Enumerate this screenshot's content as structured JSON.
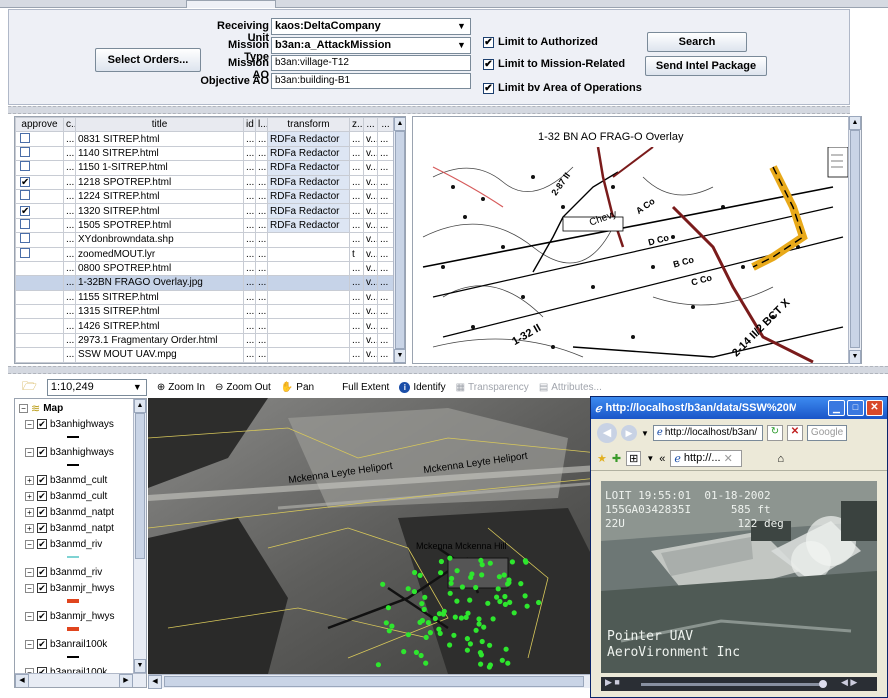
{
  "orders": {
    "select_label": "Select Orders...",
    "receiving_unit_label": "Receiving Unit",
    "receiving_unit_value": "kaos:DeltaCompany",
    "mission_type_label": "Mission Type",
    "mission_type_value": "b3an:a_AttackMission",
    "mission_ao_label": "Mission AO",
    "mission_ao_value": "b3an:village-T12",
    "objective_ao_label": "Objective AO",
    "objective_ao_value": "b3an:building-B1",
    "limit_authorized": "Limit to Authorized",
    "limit_mission": "Limit to Mission-Related",
    "limit_area": "Limit bv Area of Operations",
    "search_label": "Search",
    "send_intel_label": "Send Intel Package"
  },
  "table": {
    "headers": [
      "approve",
      "c...",
      "title",
      "id",
      "l...",
      "transform",
      "z...",
      "...",
      "..."
    ],
    "rows": [
      {
        "checked": false,
        "c": "...",
        "title": "0831 SITREP.html",
        "id": "...",
        "l": "...",
        "transform": "RDFa Redactor",
        "z": "...",
        "d1": "v...",
        "d2": "..."
      },
      {
        "checked": false,
        "c": "...",
        "title": "1140 SITREP.html",
        "id": "...",
        "l": "...",
        "transform": "RDFa Redactor",
        "z": "...",
        "d1": "v...",
        "d2": "..."
      },
      {
        "checked": false,
        "c": "...",
        "title": "1150 1-SITREP.html",
        "id": "...",
        "l": "...",
        "transform": "RDFa Redactor",
        "z": "...",
        "d1": "v...",
        "d2": "..."
      },
      {
        "checked": true,
        "c": "...",
        "title": "1218 SPOTREP.html",
        "id": "...",
        "l": "...",
        "transform": "RDFa Redactor",
        "z": "...",
        "d1": "v...",
        "d2": "..."
      },
      {
        "checked": false,
        "c": "...",
        "title": "1224 SITREP.html",
        "id": "...",
        "l": "...",
        "transform": "RDFa Redactor",
        "z": "...",
        "d1": "v...",
        "d2": "..."
      },
      {
        "checked": true,
        "c": "...",
        "title": "1320 SITREP.html",
        "id": "...",
        "l": "...",
        "transform": "RDFa Redactor",
        "z": "...",
        "d1": "v...",
        "d2": "..."
      },
      {
        "checked": false,
        "c": "...",
        "title": "1505 SPOTREP.html",
        "id": "...",
        "l": "...",
        "transform": "RDFa Redactor",
        "z": "...",
        "d1": "v...",
        "d2": "..."
      },
      {
        "checked": false,
        "c": "...",
        "title": "XYdonbrowndata.shp",
        "id": "...",
        "l": "...",
        "transform": "",
        "z": "...",
        "d1": "v...",
        "d2": "..."
      },
      {
        "checked": false,
        "c": "...",
        "title": "zoomedMOUT.lyr",
        "id": "...",
        "l": "...",
        "transform": "",
        "z": "t",
        "d1": "v...",
        "d2": "..."
      },
      {
        "checked": null,
        "c": "...",
        "title": "0800 SPOTREP.html",
        "id": "...",
        "l": "...",
        "transform": "",
        "z": "...",
        "d1": "v...",
        "d2": "..."
      },
      {
        "checked": null,
        "c": "...",
        "title": "1-32BN FRAGO Overlay.jpg",
        "id": "...",
        "l": "...",
        "transform": "",
        "z": "...",
        "d1": "v...",
        "d2": "...",
        "selected": true
      },
      {
        "checked": null,
        "c": "...",
        "title": "1155 SITREP.html",
        "id": "...",
        "l": "...",
        "transform": "",
        "z": "...",
        "d1": "v...",
        "d2": "..."
      },
      {
        "checked": null,
        "c": "...",
        "title": "1315 SITREP.html",
        "id": "...",
        "l": "...",
        "transform": "",
        "z": "...",
        "d1": "v...",
        "d2": "..."
      },
      {
        "checked": null,
        "c": "...",
        "title": "1426 SITREP.html",
        "id": "...",
        "l": "...",
        "transform": "",
        "z": "...",
        "d1": "v...",
        "d2": "..."
      },
      {
        "checked": null,
        "c": "...",
        "title": "2973.1 Fragmentary Order.html",
        "id": "...",
        "l": "...",
        "transform": "",
        "z": "...",
        "d1": "v...",
        "d2": "..."
      },
      {
        "checked": null,
        "c": "...",
        "title": "SSW MOUT UAV.mpg",
        "id": "...",
        "l": "...",
        "transform": "",
        "z": "...",
        "d1": "v...",
        "d2": "..."
      }
    ]
  },
  "overlay": {
    "title": "1-32 BN AO FRAG-O Overlay",
    "labels": [
      "2-87 II",
      "A Co",
      "D Co",
      "B Co",
      "C Co",
      "Chevy",
      "1-32 II",
      "2-14 II/2 BCT X"
    ]
  },
  "map_toolbar": {
    "scale": "1:10,249",
    "zoom_in": "Zoom In",
    "zoom_out": "Zoom Out",
    "pan": "Pan",
    "full_extent": "Full Extent",
    "identify": "Identify",
    "transparency": "Transparency",
    "attributes": "Attributes..."
  },
  "layers": {
    "root": "Map",
    "items": [
      {
        "name": "b3anhighways",
        "expander": "−",
        "symbol": "line-black"
      },
      {
        "name": "b3anhighways",
        "expander": "−",
        "symbol": "line-black"
      },
      {
        "name": "b3anmd_cult",
        "expander": "+",
        "symbol": ""
      },
      {
        "name": "b3anmd_cult",
        "expander": "+",
        "symbol": ""
      },
      {
        "name": "b3anmd_natpt",
        "expander": "+",
        "symbol": ""
      },
      {
        "name": "b3anmd_natpt",
        "expander": "+",
        "symbol": ""
      },
      {
        "name": "b3anmd_riv",
        "expander": "−",
        "symbol": "line-cyan"
      },
      {
        "name": "b3anmd_riv",
        "expander": "−",
        "symbol": ""
      },
      {
        "name": "b3anmjr_hwys",
        "expander": "−",
        "symbol": "line-red"
      },
      {
        "name": "b3anmjr_hwys",
        "expander": "−",
        "symbol": "line-red"
      },
      {
        "name": "b3anrail100k",
        "expander": "−",
        "symbol": "rail"
      },
      {
        "name": "b3anrail100k",
        "expander": "−",
        "symbol": "rail"
      }
    ]
  },
  "map": {
    "labels": [
      "Mckenna Leyte Heliport",
      "Mckenna Leyte Heliport",
      "Mckenna Mckenna Hill"
    ]
  },
  "browser": {
    "title": "http://localhost/b3an/data/SSW%20MO...",
    "address": "http://localhost/b3an/",
    "tab_label": "http://...",
    "search_placeholder": "Google",
    "video_line1": "LOIT 19:55:01  01-18-2002",
    "video_line2": "155GA0342835I      585 ft",
    "video_line3": "22U                 122 deg",
    "video_caption1": "Pointer UAV",
    "video_caption2": "AeroVironment Inc"
  },
  "colors": {
    "panel_bg": "#eef0f6",
    "selected_row": "#c6d3e8",
    "transform_cell": "#dde6f4",
    "xp_title": "#2a62d8",
    "close_red": "#d84a2a"
  }
}
